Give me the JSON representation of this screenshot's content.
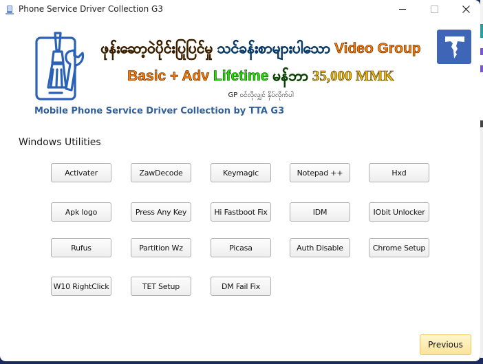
{
  "window": {
    "title": "Phone Service Driver Collection G3",
    "app_icon": "app-icon",
    "controls": {
      "minimize_icon": "minimize-icon",
      "maximize_icon": "maximize-icon",
      "close_icon": "close-icon"
    }
  },
  "banner": {
    "logo_icon": "phone-tools-icon",
    "brand_icon": "tta-logo-icon",
    "promo_line1": {
      "myanmar_part1": "ဖုန်းဆော့ဝဲပိုင်းပြုပြင်မှု",
      "myanmar_part2": "သင်ခန်းစာများပါသော",
      "english_part": "Video Group"
    },
    "promo_line2": {
      "plan": "Basic + Adv",
      "duration": "Lifetime",
      "myanmar_price_label": "မန်ဘာ",
      "price": "35,000 MMK"
    },
    "promo_line3": "GP ဝင်လိုလျှင် နှိပ်လိုက်ပါ",
    "tagline": "Mobile Phone Service Driver Collection by TTA G3"
  },
  "section": {
    "label": "Windows Utilities"
  },
  "utilities": [
    [
      "Activater",
      "ZawDecode",
      "Keymagic",
      "Notepad ++",
      "Hxd"
    ],
    [
      "Apk logo",
      "Press Any Key",
      "Hi Fastboot Fix",
      "IDM",
      "IObit Unlocker"
    ],
    [
      "Rufus",
      "Partition Wz",
      "Picasa",
      "Auth Disable",
      "Chrome Setup"
    ],
    [
      "W10 RightClick",
      "TET Setup",
      "DM Fail Fix"
    ]
  ],
  "footer": {
    "previous_label": "Previous"
  },
  "colors": {
    "tagline_blue": "#2f5f9c",
    "brand_blue": "#3f66b6",
    "promo_orange": "#ff7a00",
    "promo_green": "#22e000",
    "promo_gold": "#f0b800",
    "previous_button": "#fbe49a"
  }
}
